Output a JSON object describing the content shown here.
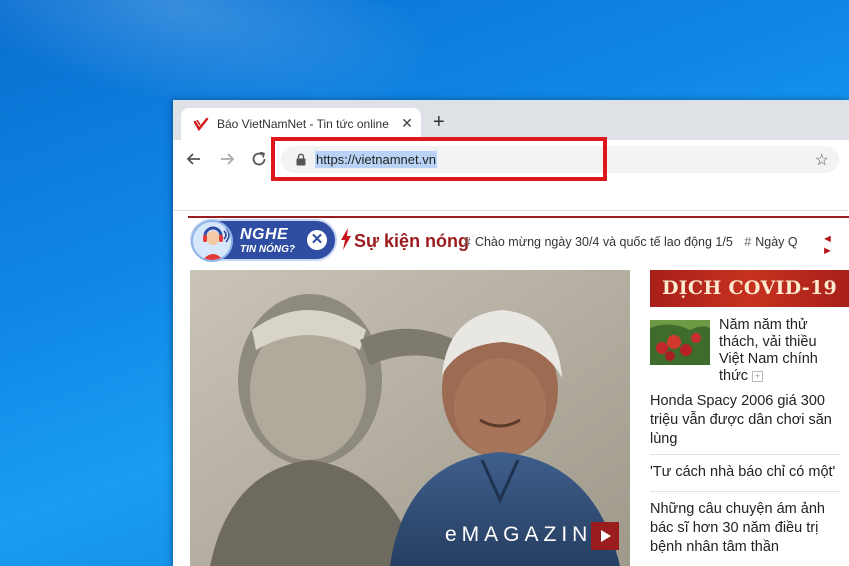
{
  "browser": {
    "tab_title": "Báo VietNamNet - Tin tức online",
    "tab_close": "✕",
    "new_tab": "+",
    "url": "https://vietnamnet.vn",
    "bookmark_star": "☆"
  },
  "hot_bar": {
    "nghe_line1": "NGHE",
    "nghe_line2": "TIN NÓNG?",
    "close_symbol": "✕",
    "title": "Sự kiện nóng",
    "ticker_items": [
      "Chào mừng ngày 30/4 và quốc tế lao động 1/5",
      "Ngày Q"
    ],
    "hash": "#",
    "arrows": "◄ ►"
  },
  "hero": {
    "label": "eMAGAZIN"
  },
  "sidebar": {
    "banner": "DỊCH COVID-19",
    "news": [
      "Năm năm thử thách, vải thiều Việt Nam chính thức",
      "Honda Spacy 2006 giá 300 triệu vẫn được dân chơi săn lùng",
      "'Tư cách nhà báo chỉ có một'",
      "Những câu chuyện ám ảnh bác sĩ hơn 30 năm điều trị bệnh nhân tâm thần"
    ],
    "more_symbol": "+"
  },
  "colors": {
    "desktop": "#0f86e6",
    "brand_red": "#9b1c1f",
    "highlight": "#e0161d",
    "nghe_blue": "#2f4ea3"
  }
}
